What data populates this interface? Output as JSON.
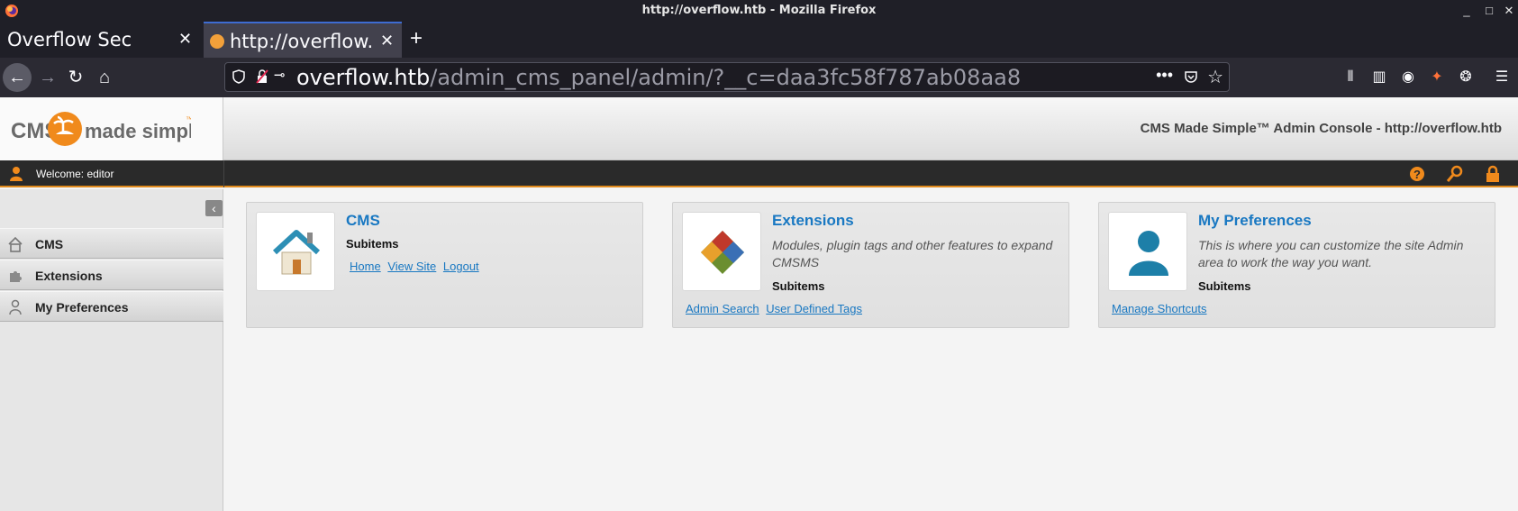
{
  "window": {
    "title": "http://overflow.htb - Mozilla Firefox",
    "controls": [
      "minimize",
      "maximize",
      "close"
    ]
  },
  "tabs": [
    {
      "title": "Overflow Sec",
      "active": false
    },
    {
      "title": "http://overflow.htb/a",
      "active": true
    }
  ],
  "navbar": {
    "url_host": "overflow.htb",
    "url_path": "/admin_cms_panel/admin/?__c=daa3fc58f787ab08aa8"
  },
  "header": {
    "logo_text": "CMS made simple",
    "logo_tm": "™",
    "title": "CMS Made Simple™ Admin Console - http://overflow.htb"
  },
  "topbar": {
    "welcome": "Welcome: editor",
    "icons": [
      "help-icon",
      "search-icon",
      "lock-icon"
    ]
  },
  "sidebar": {
    "items": [
      {
        "label": "CMS",
        "icon": "house-icon"
      },
      {
        "label": "Extensions",
        "icon": "puzzle-icon"
      },
      {
        "label": "My Preferences",
        "icon": "user-icon"
      }
    ]
  },
  "dashboard": [
    {
      "title": "CMS",
      "description": "",
      "subitems_label": "Subitems",
      "links": [
        "Home",
        "View Site",
        "Logout"
      ]
    },
    {
      "title": "Extensions",
      "description": "Modules, plugin tags and other features to expand CMSMS",
      "subitems_label": "Subitems",
      "links": [
        "Admin Search",
        "User Defined Tags"
      ]
    },
    {
      "title": "My Preferences",
      "description": "This is where you can customize the site Admin area to work the way you want.",
      "subitems_label": "Subitems",
      "links": [
        "Manage Shortcuts"
      ]
    }
  ],
  "colors": {
    "accent": "#e08a1c",
    "link": "#1978c2",
    "firefox_dark": "#1f1f27"
  }
}
